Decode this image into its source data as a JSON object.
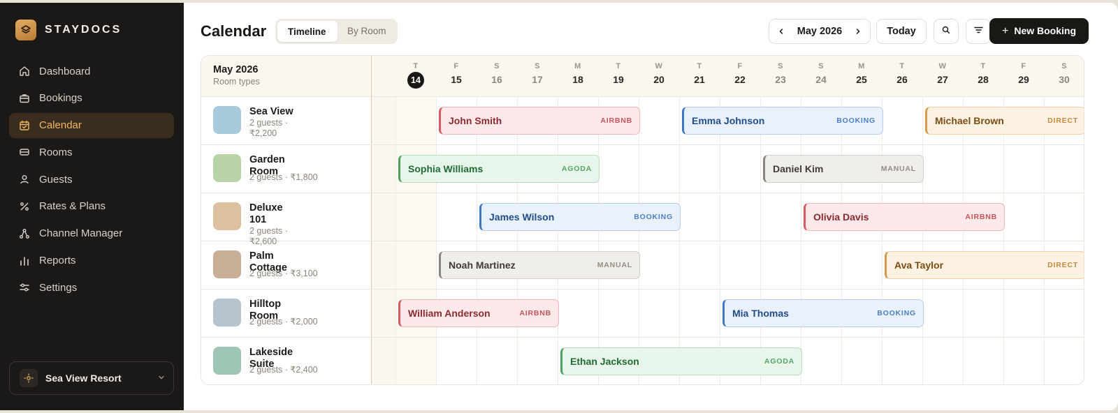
{
  "brand": {
    "name": "STAYDOCS"
  },
  "nav": [
    {
      "label": "Dashboard",
      "icon": "home-icon"
    },
    {
      "label": "Bookings",
      "icon": "briefcase-icon"
    },
    {
      "label": "Calendar",
      "icon": "calendar-icon",
      "active": true
    },
    {
      "label": "Rooms",
      "icon": "bed-icon"
    },
    {
      "label": "Guests",
      "icon": "user-icon"
    },
    {
      "label": "Rates & Plans",
      "icon": "percent-icon"
    },
    {
      "label": "Channel Manager",
      "icon": "network-icon"
    },
    {
      "label": "Reports",
      "icon": "bar-chart-icon"
    },
    {
      "label": "Settings",
      "icon": "sliders-icon"
    }
  ],
  "resort": {
    "name": "Sea View Resort"
  },
  "header": {
    "title": "Calendar",
    "views": {
      "timeline": "Timeline",
      "by_room": "By Room"
    },
    "month": "May 2026",
    "today": "Today",
    "new_booking": "New Booking"
  },
  "grid": {
    "month": "May 2026",
    "subtitle": "Room types",
    "days": [
      {
        "dow": "T",
        "num": "14",
        "today": true
      },
      {
        "dow": "F",
        "num": "15"
      },
      {
        "dow": "S",
        "num": "16",
        "weekend": true
      },
      {
        "dow": "S",
        "num": "17",
        "weekend": true
      },
      {
        "dow": "M",
        "num": "18"
      },
      {
        "dow": "T",
        "num": "19"
      },
      {
        "dow": "W",
        "num": "20"
      },
      {
        "dow": "T",
        "num": "21"
      },
      {
        "dow": "F",
        "num": "22"
      },
      {
        "dow": "S",
        "num": "23",
        "weekend": true
      },
      {
        "dow": "S",
        "num": "24",
        "weekend": true
      },
      {
        "dow": "M",
        "num": "25"
      },
      {
        "dow": "T",
        "num": "26"
      },
      {
        "dow": "W",
        "num": "27"
      },
      {
        "dow": "T",
        "num": "28"
      },
      {
        "dow": "F",
        "num": "29"
      },
      {
        "dow": "S",
        "num": "30",
        "weekend": true
      }
    ],
    "rooms": [
      {
        "name": "Sea View",
        "sub": "2 guests · ₹2,200",
        "color": "#a9c9dc"
      },
      {
        "name": "Garden Room",
        "sub": "2 guests · ₹1,800",
        "color": "#b8d3a8"
      },
      {
        "name": "Deluxe 101",
        "sub": "2 guests · ₹2,600",
        "color": "#dcc0a0"
      },
      {
        "name": "Palm Cottage",
        "sub": "2 guests · ₹3,100",
        "color": "#c9ae98"
      },
      {
        "name": "Hilltop Room",
        "sub": "2 guests · ₹2,000",
        "color": "#b5c3ce"
      },
      {
        "name": "Lakeside Suite",
        "sub": "2 guests · ₹2,400",
        "color": "#9fc6b4"
      }
    ],
    "bookings": [
      {
        "guest": "John Smith",
        "source": "AIRBNB",
        "room": 0,
        "start": 15,
        "end": 20
      },
      {
        "guest": "Emma Johnson",
        "source": "BOOKING",
        "room": 0,
        "start": 21,
        "end": 26
      },
      {
        "guest": "Michael Brown",
        "source": "DIRECT",
        "room": 0,
        "start": 27,
        "end": 31
      },
      {
        "guest": "Sophia Williams",
        "source": "AGODA",
        "room": 1,
        "start": 14,
        "end": 19
      },
      {
        "guest": "Daniel Kim",
        "source": "MANUAL",
        "room": 1,
        "start": 23,
        "end": 27
      },
      {
        "guest": "James Wilson",
        "source": "BOOKING",
        "room": 2,
        "start": 16,
        "end": 21
      },
      {
        "guest": "Olivia Davis",
        "source": "AIRBNB",
        "room": 2,
        "start": 24,
        "end": 29
      },
      {
        "guest": "Noah Martinez",
        "source": "MANUAL",
        "room": 3,
        "start": 15,
        "end": 20
      },
      {
        "guest": "Ava Taylor",
        "source": "DIRECT",
        "room": 3,
        "start": 26,
        "end": 31
      },
      {
        "guest": "William Anderson",
        "source": "AIRBNB",
        "room": 4,
        "start": 14,
        "end": 18
      },
      {
        "guest": "Mia Thomas",
        "source": "BOOKING",
        "room": 4,
        "start": 22,
        "end": 27
      },
      {
        "guest": "Ethan Jackson",
        "source": "AGODA",
        "room": 5,
        "start": 18,
        "end": 24
      }
    ]
  }
}
